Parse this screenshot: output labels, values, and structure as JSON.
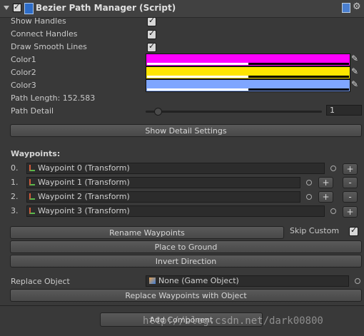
{
  "header": {
    "title": "Bezier Path Manager (Script)"
  },
  "toggles": {
    "show_handles": "Show Handles",
    "connect_handles": "Connect Handles",
    "draw_smooth_lines": "Draw Smooth Lines"
  },
  "colors": [
    {
      "label": "Color1",
      "hex": "#ff00ff"
    },
    {
      "label": "Color2",
      "hex": "#ffe600"
    },
    {
      "label": "Color3",
      "hex": "#7fa6ff"
    }
  ],
  "path_length": "Path Length: 152.583",
  "path_detail": {
    "label": "Path Detail",
    "value": "1",
    "level": 0.05
  },
  "buttons": {
    "show_detail_settings": "Show Detail Settings",
    "rename_waypoints": "Rename Waypoints",
    "place_to_ground": "Place to Ground",
    "invert_direction": "Invert Direction",
    "replace_waypoints": "Replace Waypoints with Object",
    "add_component": "Add Component",
    "plus": "+",
    "minus": "-"
  },
  "waypoints": {
    "heading": "Waypoints:",
    "items": [
      {
        "index": "0.",
        "name": "Waypoint 0 (Transform)"
      },
      {
        "index": "1.",
        "name": "Waypoint 1 (Transform)"
      },
      {
        "index": "2.",
        "name": "Waypoint 2 (Transform)"
      },
      {
        "index": "3.",
        "name": "Waypoint 3 (Transform)"
      }
    ]
  },
  "skip_custom": "Skip Custom",
  "replace_object": {
    "label": "Replace Object",
    "value": "None (Game Object)"
  },
  "watermark": "http://blog.csdn.net/dark00800"
}
